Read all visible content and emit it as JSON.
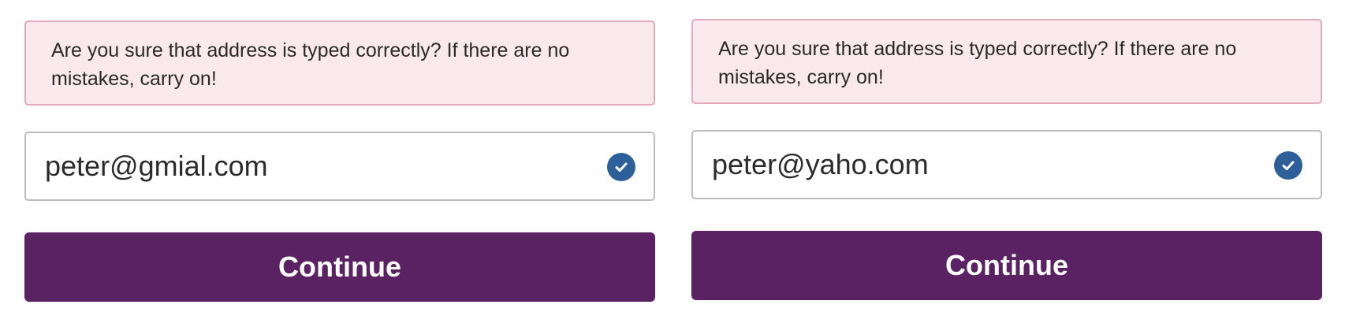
{
  "colors": {
    "warning_bg": "#f9e8ec",
    "warning_border": "#e3a9bd",
    "check_icon": "#2d5f98",
    "continue_button": "#5b2263",
    "continue_text": "#ffffff"
  },
  "panels": [
    {
      "warning_text": "Are you sure that address is typed correctly? If there are no mistakes, carry on!",
      "email_value": "peter@gmial.com",
      "valid_icon": "check-circle-icon",
      "continue_label": "Continue"
    },
    {
      "warning_text": "Are you sure that address is typed correctly? If there are no mistakes, carry on!",
      "email_value": "peter@yaho.com",
      "valid_icon": "check-circle-icon",
      "continue_label": "Continue"
    }
  ]
}
